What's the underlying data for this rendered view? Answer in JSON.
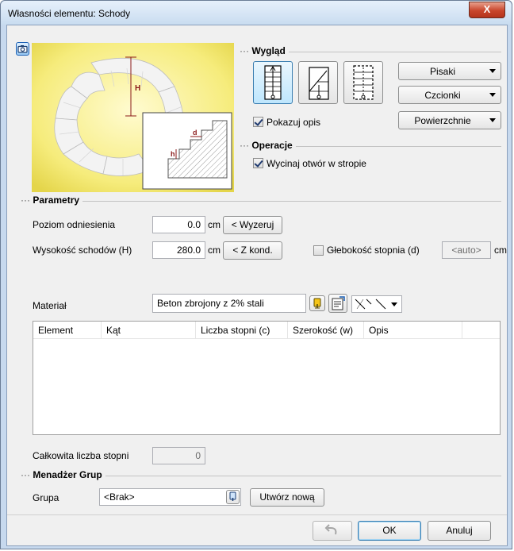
{
  "window": {
    "title": "Własności elementu: Schody",
    "close_label": "X"
  },
  "appearance": {
    "section_title": "Wygląd",
    "style_icons": [
      "stairs-plan-icon",
      "stairs-section-icon",
      "stairs-dashed-plan-icon"
    ],
    "selected_style": 0,
    "pens_label": "Pisaki",
    "fonts_label": "Czcionki",
    "surfaces_label": "Powierzchnie",
    "show_description_label": "Pokazuj opis",
    "show_description_checked": true
  },
  "operations": {
    "section_title": "Operacje",
    "cut_opening_label": "Wycinaj otwór w stropie",
    "cut_opening_checked": true
  },
  "preview": {
    "height_label": "H",
    "tread_depth_label": "d",
    "riser_height_label": "h"
  },
  "parameters": {
    "section_title": "Parametry",
    "ref_level_label": "Poziom odniesienia",
    "ref_level_value": "0.0",
    "ref_level_unit": "cm",
    "reset_button": "< Wyzeruj",
    "stairs_height_label": "Wysokość schodów (H)",
    "stairs_height_value": "280.0",
    "stairs_height_unit": "cm",
    "from_storey_button": "< Z kond.",
    "step_depth_label": "Głebokość stopnia (d)",
    "step_depth_checked": false,
    "step_depth_value": "<auto>",
    "step_depth_unit": "cm"
  },
  "material": {
    "label": "Materiał",
    "value": "Beton zbrojony z 2% stali"
  },
  "table": {
    "columns": [
      "Element",
      "Kąt",
      "Liczba stopni (c)",
      "Szerokość (w)",
      "Opis"
    ],
    "rows": []
  },
  "total_steps": {
    "label": "Całkowita liczba stopni",
    "value": "0"
  },
  "group_manager": {
    "section_title": "Menadżer Grup",
    "group_label": "Grupa",
    "group_value": "<Brak>",
    "create_new_button": "Utwórz nową"
  },
  "footer": {
    "ok_label": "OK",
    "cancel_label": "Anuluj"
  }
}
